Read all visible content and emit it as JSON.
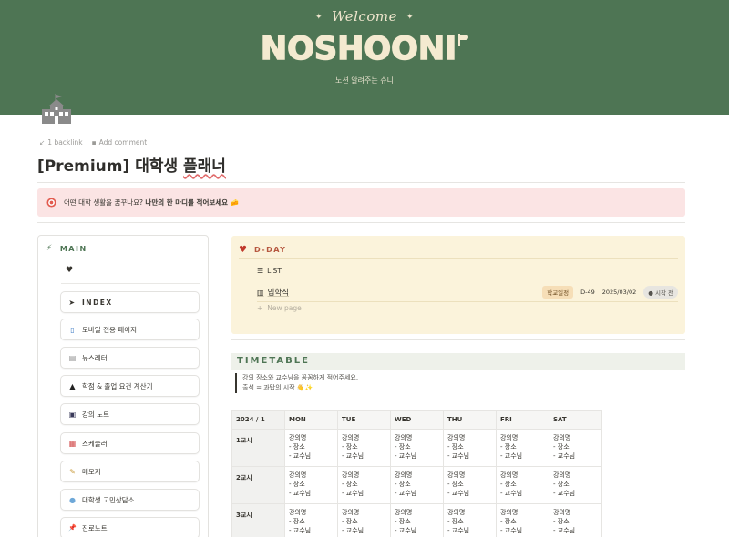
{
  "banner": {
    "welcome": "Welcome",
    "logo": "NOSHOONI",
    "tagline": "노션 알려주는 슈니",
    "colors": {
      "background": "#4e7554",
      "text": "#f4ead0"
    }
  },
  "page": {
    "icon": "school-icon",
    "meta": {
      "backlink": "1 backlink",
      "comment": "Add comment"
    },
    "title_prefix": "[Premium] 대학생 ",
    "title_underlined": "플래너",
    "callout": {
      "icon": "target-icon",
      "text_plain": "어떤 대학 생활을 꿈꾸나요? ",
      "text_bold": "나만의 한 마디를 적어보세요",
      "emoji": "🧀",
      "background": "#fbe4e4"
    }
  },
  "sidebar": {
    "header": "MAIN",
    "heart": "♥",
    "items": [
      {
        "label": "INDEX",
        "icon": "cursor-icon",
        "glyph": "➤"
      },
      {
        "label": "모바일 전용 페이지",
        "icon": "phone-icon",
        "glyph": "▯"
      },
      {
        "label": "뉴스레터",
        "icon": "newspaper-icon",
        "glyph": "▤"
      },
      {
        "label": "학점 & 졸업 요건 계산기",
        "icon": "graduation-cap-icon",
        "glyph": "▲"
      },
      {
        "label": "강의 노트",
        "icon": "notebook-icon",
        "glyph": "▣"
      },
      {
        "label": "스케줄러",
        "icon": "calendar-icon",
        "glyph": "▦"
      },
      {
        "label": "메모지",
        "icon": "memo-icon",
        "glyph": "✎"
      },
      {
        "label": "대학생 고민상담소",
        "icon": "speech-bubble-icon",
        "glyph": "●"
      },
      {
        "label": "진로노트",
        "icon": "pushpin-icon",
        "glyph": "📌"
      }
    ]
  },
  "dday": {
    "header": "D-DAY",
    "list_tab": "LIST",
    "entry": {
      "name": "입학식",
      "category": "학교일정",
      "dday": "D-49",
      "date": "2025/03/02",
      "status": "시작 전"
    },
    "new_page": "New page",
    "background": "#fbf3db"
  },
  "timetable": {
    "header": "TIMETABLE",
    "note_line1": "강의 장소와 교수님을 꼼꼼하게 적어주세요.",
    "note_line2": "출석 = 과탑의 시작 👋✨",
    "corner": "2024 / 1",
    "days": [
      "MON",
      "TUE",
      "WED",
      "THU",
      "FRI",
      "SAT"
    ],
    "periods": [
      "1교시",
      "2교시",
      "3교시"
    ],
    "cell": {
      "line1": "강의명",
      "line2": "- 장소",
      "line3": "- 교수님"
    }
  }
}
